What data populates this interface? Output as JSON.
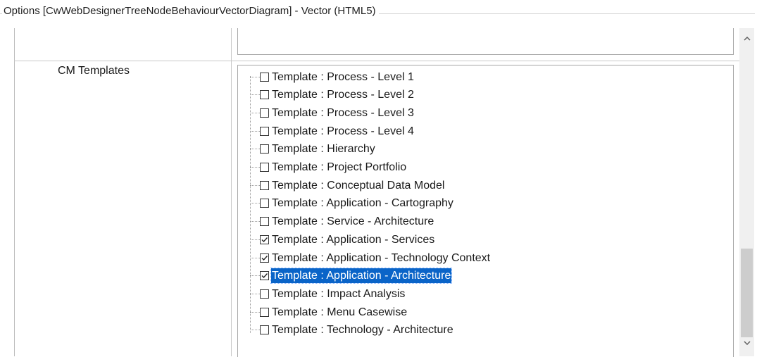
{
  "window": {
    "title": "Options [CwWebDesignerTreeNodeBehaviourVectorDiagram] - Vector (HTML5)"
  },
  "options": {
    "row_label": "CM Templates",
    "templates": [
      {
        "label": "Template : Process - Level 1",
        "checked": false,
        "selected": false
      },
      {
        "label": "Template : Process - Level 2",
        "checked": false,
        "selected": false
      },
      {
        "label": "Template : Process - Level 3",
        "checked": false,
        "selected": false
      },
      {
        "label": "Template : Process - Level 4",
        "checked": false,
        "selected": false
      },
      {
        "label": "Template : Hierarchy",
        "checked": false,
        "selected": false
      },
      {
        "label": "Template : Project Portfolio",
        "checked": false,
        "selected": false
      },
      {
        "label": "Template : Conceptual Data Model",
        "checked": false,
        "selected": false
      },
      {
        "label": "Template : Application - Cartography",
        "checked": false,
        "selected": false
      },
      {
        "label": "Template : Service - Architecture",
        "checked": false,
        "selected": false
      },
      {
        "label": "Template : Application - Services",
        "checked": true,
        "selected": false
      },
      {
        "label": "Template : Application - Technology Context",
        "checked": true,
        "selected": false
      },
      {
        "label": "Template : Application - Architecture",
        "checked": true,
        "selected": true
      },
      {
        "label": "Template : Impact Analysis",
        "checked": false,
        "selected": false
      },
      {
        "label": "Template : Menu Casewise",
        "checked": false,
        "selected": false
      },
      {
        "label": "Template : Technology - Architecture",
        "checked": false,
        "selected": false
      }
    ]
  },
  "icons": {
    "scroll_up": "chevron-up-icon",
    "scroll_down": "chevron-down-icon",
    "check": "checkmark-icon"
  },
  "colors": {
    "selection": "#0a64c8",
    "selection_text": "#ffffff"
  }
}
